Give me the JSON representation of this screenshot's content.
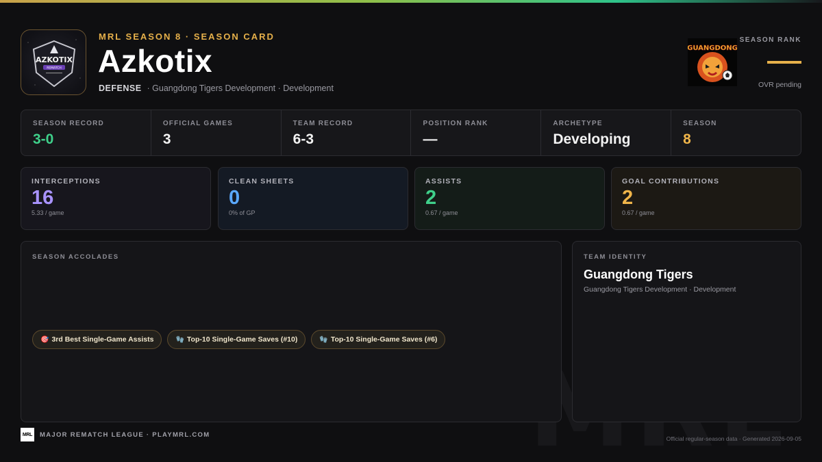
{
  "header": {
    "eyebrow": "MRL SEASON 8 · SEASON CARD",
    "player_name": "Azkotix",
    "position": "DEFENSE",
    "team_line": "· Guangdong Tigers Development · Development",
    "player_logo_text": "AZKOTIX",
    "player_logo_sub": "REMATCH",
    "team_logo_text": "GUANGDONG",
    "rank_label": "SEASON RANK",
    "ovr_text": "OVR pending"
  },
  "strip": [
    {
      "label": "SEASON RECORD",
      "value": "3-0",
      "color": "#3fd08a"
    },
    {
      "label": "OFFICIAL GAMES",
      "value": "3"
    },
    {
      "label": "TEAM RECORD",
      "value": "6-3"
    },
    {
      "label": "POSITION RANK",
      "value": "—"
    },
    {
      "label": "ARCHETYPE",
      "value": "Developing"
    },
    {
      "label": "SEASON",
      "value": "8",
      "color": "#f0b54a"
    }
  ],
  "highlights": [
    {
      "label": "INTERCEPTIONS",
      "value": "16",
      "sub": "5.33 / game",
      "color": "#a993ff"
    },
    {
      "label": "CLEAN SHEETS",
      "value": "0",
      "sub": "0% of GP",
      "color": "#5aa8ff"
    },
    {
      "label": "ASSISTS",
      "value": "2",
      "sub": "0.67 / game",
      "color": "#3fd08a"
    },
    {
      "label": "GOAL CONTRIBUTIONS",
      "value": "2",
      "sub": "0.67 / game",
      "color": "#f0b54a"
    }
  ],
  "accolades": {
    "label": "SEASON ACCOLADES",
    "items": [
      {
        "icon": "🎯",
        "icon_name": "target-icon",
        "text": "3rd Best Single-Game Assists"
      },
      {
        "icon": "🧤",
        "icon_name": "glove-icon",
        "text": "Top-10 Single-Game Saves (#10)"
      },
      {
        "icon": "🧤",
        "icon_name": "glove-icon",
        "text": "Top-10 Single-Game Saves (#6)"
      }
    ]
  },
  "team_identity": {
    "label": "TEAM IDENTITY",
    "name": "Guangdong Tigers",
    "sub": "Guangdong Tigers Development · Development"
  },
  "footer": {
    "logo_text": "MRL",
    "left": "MAJOR REMATCH LEAGUE · PLAYMRL.COM",
    "right": "Official regular-season data · Generated 2026-09-05",
    "watermark": "MRL"
  }
}
